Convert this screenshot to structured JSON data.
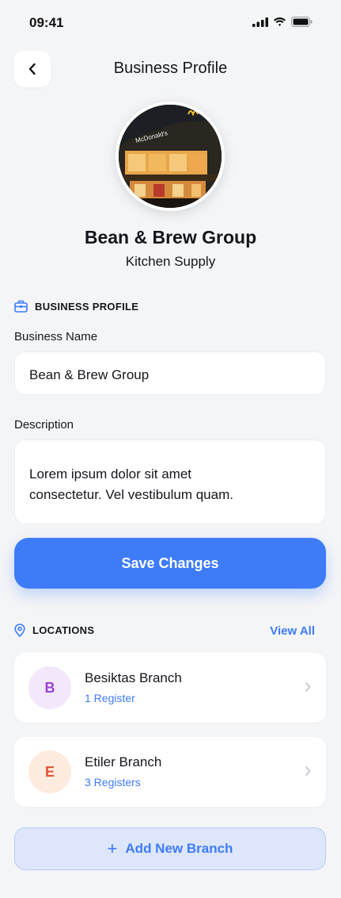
{
  "status": {
    "time": "09:41"
  },
  "header": {
    "title": "Business Profile",
    "back_icon": "chevron-left-icon"
  },
  "profile": {
    "name": "Bean & Brew Group",
    "category": "Kitchen Supply",
    "sign_text": "McDonald's"
  },
  "business_section": {
    "label": "BUSINESS PROFILE",
    "icon": "briefcase-icon",
    "name_label": "Business Name",
    "name_value": "Bean & Brew Group",
    "description_label": "Description",
    "description_line1": "Lorem ipsum dolor sit amet",
    "description_line2": "consectetur. Vel vestibulum quam."
  },
  "save_label": "Save Changes",
  "locations": {
    "label": "LOCATIONS",
    "icon": "map-pin-icon",
    "view_all": "View All",
    "items": [
      {
        "initial": "B",
        "name": "Besiktas Branch",
        "sub": "1 Register",
        "bg": "#f3e8fb",
        "fg": "#9b3fd0"
      },
      {
        "initial": "E",
        "name": "Etiler Branch",
        "sub": "3 Registers",
        "bg": "#fdebdf",
        "fg": "#e0543a"
      }
    ]
  },
  "add_branch": {
    "plus": "+",
    "label": "Add New Branch"
  },
  "colors": {
    "accent": "#3d7bf7",
    "background": "#f4f5f7"
  }
}
